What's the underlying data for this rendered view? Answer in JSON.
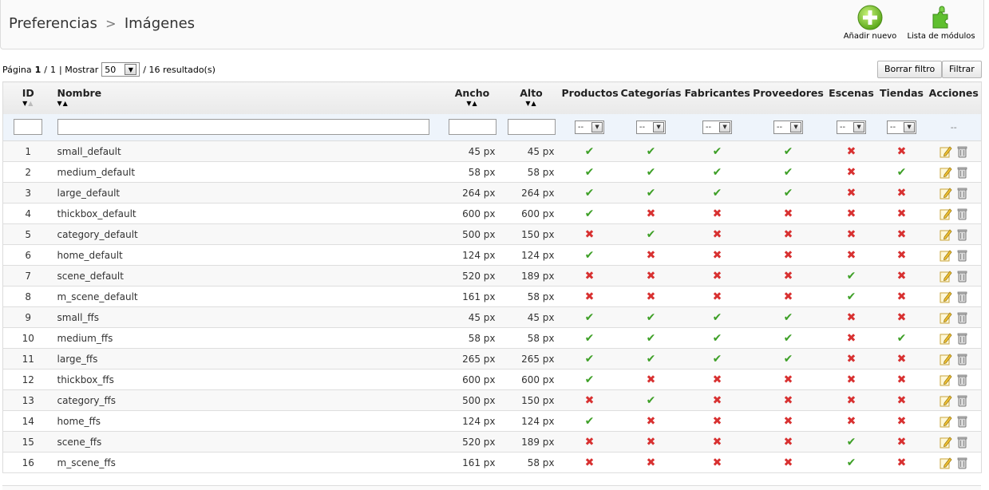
{
  "breadcrumb": {
    "parent": "Preferencias",
    "separator": ">",
    "current": "Imágenes"
  },
  "toolbar": {
    "add_label": "Añadir nuevo",
    "modules_label": "Lista de módulos"
  },
  "pager": {
    "page_label": "Página",
    "page": "1",
    "page_sep": "/",
    "total_pages": "1",
    "show_label": "| Mostrar",
    "per_page": "50",
    "results": "/ 16 resultado(s)"
  },
  "buttons": {
    "reset": "Borrar filtro",
    "filter": "Filtrar"
  },
  "columns": {
    "id": "ID",
    "name": "Nombre",
    "width": "Ancho",
    "height": "Alto",
    "products": "Productos",
    "categories": "Categorías",
    "manufacturers": "Fabricantes",
    "suppliers": "Proveedores",
    "scenes": "Escenas",
    "stores": "Tiendas",
    "actions": "Acciones"
  },
  "filter": {
    "select_value": "--",
    "actions_placeholder": "--"
  },
  "colors": {
    "check": "#3d9f26",
    "cross": "#d83131"
  },
  "icons": {
    "yes": "check-icon",
    "no": "cross-icon",
    "edit": "edit-icon",
    "delete": "delete-icon"
  },
  "rows": [
    {
      "id": "1",
      "name": "small_default",
      "width": "45 px",
      "height": "45 px",
      "flags": [
        1,
        1,
        1,
        1,
        0,
        0
      ]
    },
    {
      "id": "2",
      "name": "medium_default",
      "width": "58 px",
      "height": "58 px",
      "flags": [
        1,
        1,
        1,
        1,
        0,
        1
      ]
    },
    {
      "id": "3",
      "name": "large_default",
      "width": "264 px",
      "height": "264 px",
      "flags": [
        1,
        1,
        1,
        1,
        0,
        0
      ]
    },
    {
      "id": "4",
      "name": "thickbox_default",
      "width": "600 px",
      "height": "600 px",
      "flags": [
        1,
        0,
        0,
        0,
        0,
        0
      ]
    },
    {
      "id": "5",
      "name": "category_default",
      "width": "500 px",
      "height": "150 px",
      "flags": [
        0,
        1,
        0,
        0,
        0,
        0
      ]
    },
    {
      "id": "6",
      "name": "home_default",
      "width": "124 px",
      "height": "124 px",
      "flags": [
        1,
        0,
        0,
        0,
        0,
        0
      ]
    },
    {
      "id": "7",
      "name": "scene_default",
      "width": "520 px",
      "height": "189 px",
      "flags": [
        0,
        0,
        0,
        0,
        1,
        0
      ]
    },
    {
      "id": "8",
      "name": "m_scene_default",
      "width": "161 px",
      "height": "58 px",
      "flags": [
        0,
        0,
        0,
        0,
        1,
        0
      ]
    },
    {
      "id": "9",
      "name": "small_ffs",
      "width": "45 px",
      "height": "45 px",
      "flags": [
        1,
        1,
        1,
        1,
        0,
        0
      ]
    },
    {
      "id": "10",
      "name": "medium_ffs",
      "width": "58 px",
      "height": "58 px",
      "flags": [
        1,
        1,
        1,
        1,
        0,
        1
      ]
    },
    {
      "id": "11",
      "name": "large_ffs",
      "width": "265 px",
      "height": "265 px",
      "flags": [
        1,
        1,
        1,
        1,
        0,
        0
      ]
    },
    {
      "id": "12",
      "name": "thickbox_ffs",
      "width": "600 px",
      "height": "600 px",
      "flags": [
        1,
        0,
        0,
        0,
        0,
        0
      ]
    },
    {
      "id": "13",
      "name": "category_ffs",
      "width": "500 px",
      "height": "150 px",
      "flags": [
        0,
        1,
        0,
        0,
        0,
        0
      ]
    },
    {
      "id": "14",
      "name": "home_ffs",
      "width": "124 px",
      "height": "124 px",
      "flags": [
        1,
        0,
        0,
        0,
        0,
        0
      ]
    },
    {
      "id": "15",
      "name": "scene_ffs",
      "width": "520 px",
      "height": "189 px",
      "flags": [
        0,
        0,
        0,
        0,
        1,
        0
      ]
    },
    {
      "id": "16",
      "name": "m_scene_ffs",
      "width": "161 px",
      "height": "58 px",
      "flags": [
        0,
        0,
        0,
        0,
        1,
        0
      ]
    }
  ]
}
